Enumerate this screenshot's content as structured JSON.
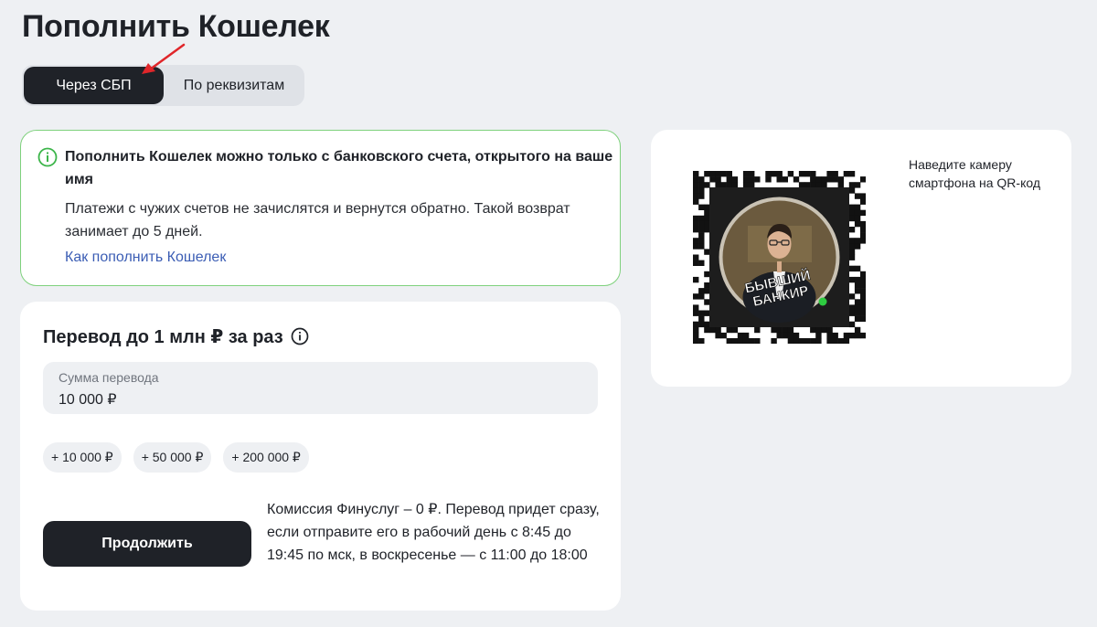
{
  "page": {
    "title": "Пополнить Кошелек"
  },
  "tabs": [
    {
      "label": "Через СБП",
      "active": true
    },
    {
      "label": "По реквизитам",
      "active": false
    }
  ],
  "notice": {
    "title": "Пополнить Кошелек можно только с банковского счета, открытого на ваше имя",
    "text": "Платежи с чужих счетов не зачислятся и вернутся обратно. Такой возврат занимает до 5 дней.",
    "link": "Как пополнить Кошелек",
    "icon": "info-icon",
    "border_color": "#7fd17d"
  },
  "transfer": {
    "title": "Перевод до 1 млн ₽ за раз",
    "amount_label": "Сумма перевода",
    "amount_value": "10 000 ₽",
    "chips": [
      "+ 10 000 ₽",
      "+ 50 000 ₽",
      "+ 200 000 ₽"
    ],
    "continue_label": "Продолжить",
    "commission": "Комиссия Финуслуг – 0 ₽. Перевод придет сразу, если отправите его в рабочий день с 8:45 до 19:45  по мск, в воскресенье — с 11:00 до 18:00"
  },
  "qr": {
    "hint": "Наведите камеру смартфона на QR-код",
    "logo_text_line1": "БЫВШИЙ",
    "logo_text_line2": "БАНКИР"
  },
  "colors": {
    "background": "#eef0f3",
    "dark": "#1f2228",
    "link": "#3b5db4",
    "annotation_arrow": "#e0262a"
  }
}
